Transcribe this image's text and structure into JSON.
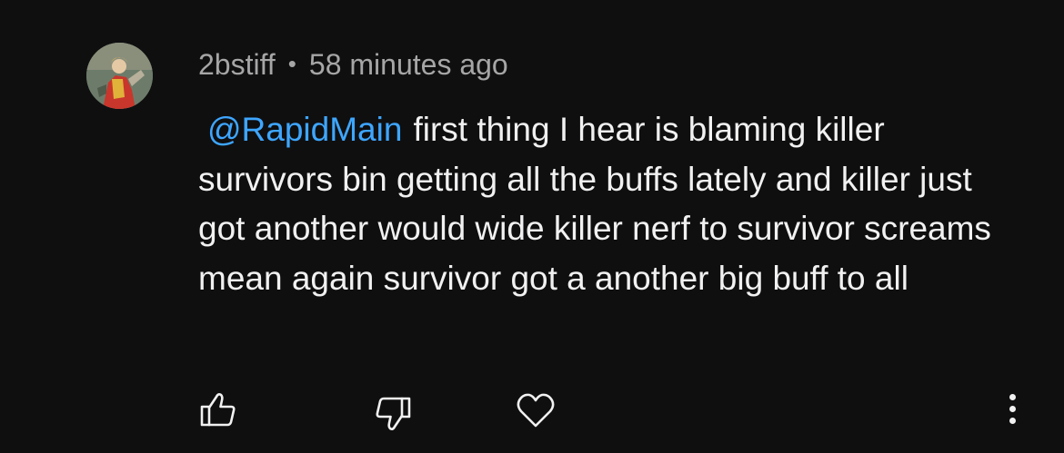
{
  "comment": {
    "author": "2bstiff",
    "separator": "•",
    "time": "58 minutes ago",
    "mention": "@RapidMain",
    "text": "first thing I hear is blaming killer survivors bin getting all the buffs lately and killer just got another would wide killer nerf to survivor screams mean again survivor got a another big buff to all"
  },
  "actions": {
    "like_icon": "thumbs-up-icon",
    "dislike_icon": "thumbs-down-icon",
    "heart_icon": "heart-icon",
    "more_icon": "more-vertical-icon"
  },
  "colors": {
    "background": "#0f0f10",
    "text": "#f1f1f1",
    "meta": "#a6a6a6",
    "mention": "#3ea6ff"
  }
}
